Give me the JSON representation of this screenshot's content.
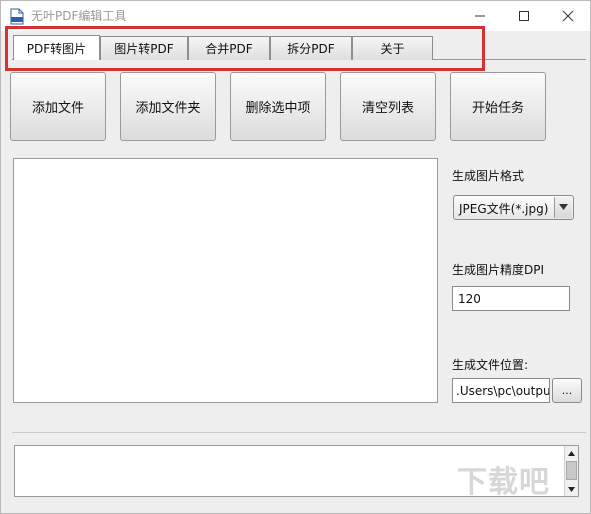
{
  "window": {
    "title": "无叶PDF编辑工具"
  },
  "tabs": [
    {
      "label": "PDF转图片",
      "active": true
    },
    {
      "label": "图片转PDF",
      "active": false
    },
    {
      "label": "合并PDF",
      "active": false
    },
    {
      "label": "拆分PDF",
      "active": false
    },
    {
      "label": "关于",
      "active": false
    }
  ],
  "toolbar": {
    "add_file": "添加文件",
    "add_folder": "添加文件夹",
    "delete_selected": "删除选中项",
    "clear_list": "清空列表",
    "start_task": "开始任务"
  },
  "settings": {
    "format_label": "生成图片格式",
    "format_value": "JPEG文件(*.jpg)",
    "dpi_label": "生成图片精度DPI",
    "dpi_value": "120",
    "output_label": "生成文件位置:",
    "output_value": ".Users\\pc\\output",
    "browse_label": "..."
  },
  "watermark": {
    "text": "下载吧"
  },
  "colors": {
    "highlight": "#d73232",
    "window_bg": "#eeeeee"
  }
}
